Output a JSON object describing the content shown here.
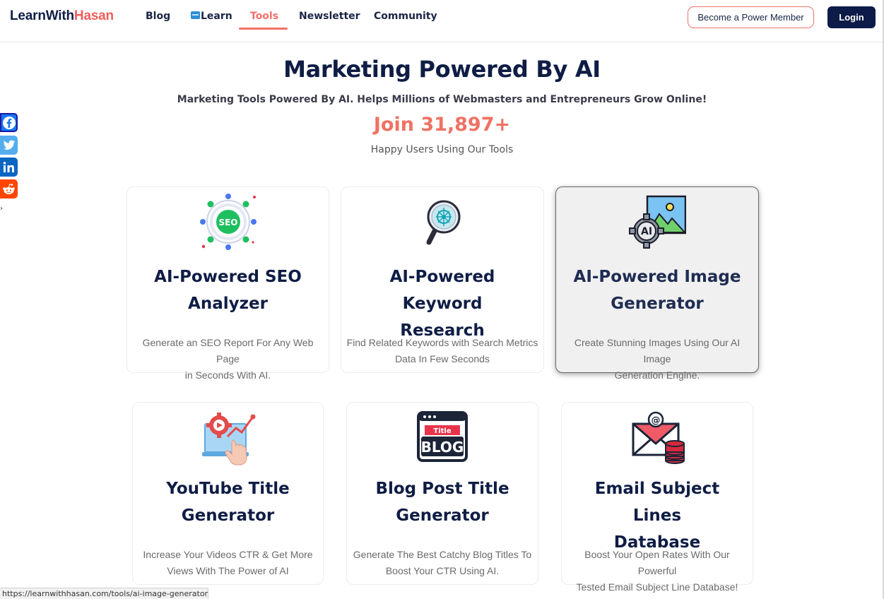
{
  "header": {
    "logo_part1": "LearnWith",
    "logo_part2": "Hasan",
    "nav": [
      {
        "label": "Blog"
      },
      {
        "label": "Learn"
      },
      {
        "label": "Tools"
      },
      {
        "label": "Newsletter"
      },
      {
        "label": "Community"
      }
    ],
    "active_nav": "Tools",
    "power_member_label": "Become a Power Member",
    "login_label": "Login"
  },
  "hero": {
    "title": "Marketing Powered By AI",
    "subtitle": "Marketing Tools Powered By AI. Helps Millions of Webmasters and Entrepreneurs Grow Online!",
    "join_text": "Join 31,897+",
    "happy_text": "Happy Users Using Our Tools"
  },
  "share": [
    "facebook-icon",
    "twitter-icon",
    "linkedin-icon",
    "reddit-icon"
  ],
  "cards": [
    {
      "icon": "seo-network-icon",
      "title_line1": "AI-Powered SEO",
      "title_line2": "Analyzer",
      "desc_line1": "Generate an SEO Report For Any Web Page",
      "desc_line2": "in Seconds With AI."
    },
    {
      "icon": "keyword-magnifier-icon",
      "title_line1": "AI-Powered Keyword",
      "title_line2": "Research",
      "desc_line1": "Find Related Keywords with Search Metrics",
      "desc_line2": "Data In Few Seconds"
    },
    {
      "icon": "ai-image-icon",
      "title_line1": "AI-Powered Image",
      "title_line2": "Generator",
      "desc_line1": "Create Stunning Images Using Our AI Image",
      "desc_line2": "Generation Engine."
    },
    {
      "icon": "youtube-growth-icon",
      "title_line1": "YouTube Title",
      "title_line2": "Generator",
      "desc_line1": "Increase Your Videos CTR & Get More",
      "desc_line2": "Views With The Power of AI"
    },
    {
      "icon": "blog-title-icon",
      "title_line1": "Blog Post Title",
      "title_line2": "Generator",
      "desc_line1": "Generate The Best Catchy Blog Titles To",
      "desc_line2": "Boost Your CTR Using AI.",
      "icon_text_title": "Title",
      "icon_text_blog": "BLOG"
    },
    {
      "icon": "email-database-icon",
      "title_line1": "Email Subject Lines",
      "title_line2": "Database",
      "desc_line1": "Boost Your Open Rates With Our Powerful",
      "desc_line2": "Tested Email Subject Line Database!"
    }
  ],
  "seo_icon_text": "SEO",
  "ai_icon_text": "AI",
  "status_url": "https://learnwithhasan.com/tools/ai-image-generator/",
  "colors": {
    "navy": "#0f1d45",
    "accent": "#f0706b",
    "login_bg": "#0c1b47"
  }
}
